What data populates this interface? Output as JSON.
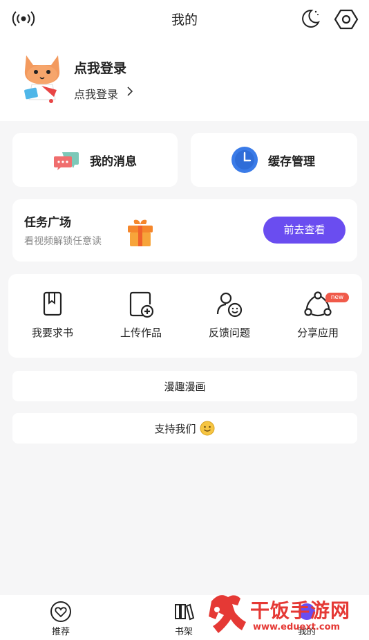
{
  "header": {
    "title": "我的",
    "icons": [
      "broadcast-icon",
      "moon-icon",
      "settings-icon"
    ]
  },
  "profile": {
    "name": "点我登录",
    "action": "点我登录"
  },
  "quick_cards": [
    {
      "label": "我的消息",
      "icon": "chat-bubbles-icon"
    },
    {
      "label": "缓存管理",
      "icon": "clock-icon"
    }
  ],
  "task": {
    "title": "任务广场",
    "subtitle": "看视频解锁任意读",
    "button": "前去查看"
  },
  "tools": [
    {
      "label": "我要求书",
      "icon": "book-icon"
    },
    {
      "label": "上传作品",
      "icon": "upload-doc-icon"
    },
    {
      "label": "反馈问题",
      "icon": "feedback-icon"
    },
    {
      "label": "分享应用",
      "icon": "share-icon",
      "badge": "new"
    }
  ],
  "rows": [
    {
      "label": "漫趣漫画"
    },
    {
      "label": "支持我们",
      "icon": "smiley-icon"
    }
  ],
  "bottom_nav": [
    {
      "label": "推荐",
      "icon": "heart-icon"
    },
    {
      "label": "书架",
      "icon": "bookshelf-icon"
    },
    {
      "label": "我的",
      "icon": "profile-icon"
    }
  ],
  "watermark": {
    "brand": "干饭手游网",
    "url": "www.eduext.com"
  },
  "colors": {
    "accent": "#6a4df0",
    "badge": "#f05a4a",
    "clock_blue": "#3a7be8",
    "gift_orange": "#f5862b",
    "watermark_red": "#e53935"
  }
}
